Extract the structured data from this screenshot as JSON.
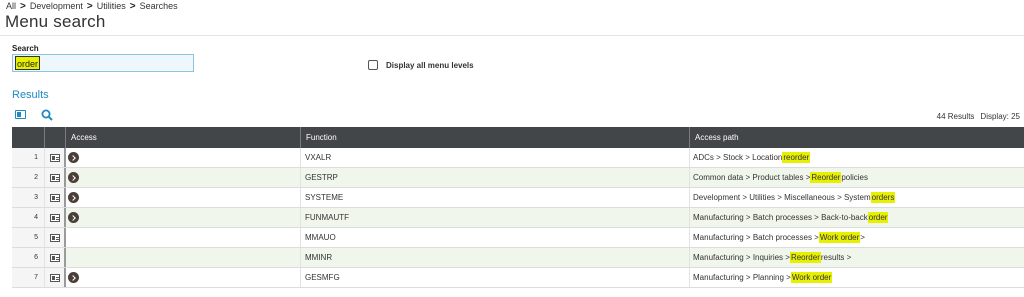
{
  "breadcrumb": {
    "items": [
      "All",
      "Development",
      "Utilities",
      "Searches"
    ],
    "separator": ">"
  },
  "page_title": "Menu search",
  "search": {
    "label": "Search",
    "value": "order"
  },
  "display_all_levels": {
    "label": "Display all menu levels",
    "checked": false
  },
  "results": {
    "title": "Results",
    "count_text": "44 Results",
    "display_text": "Display: 25",
    "columns": {
      "access": "Access",
      "function": "Function",
      "access_path": "Access path"
    },
    "rows": [
      {
        "num": "1",
        "has_access": true,
        "function": "VXALR",
        "path_pre": "ADCs > Stock > Location ",
        "path_hl": "reorder",
        "path_post": ""
      },
      {
        "num": "2",
        "has_access": true,
        "function": "GESTRP",
        "path_pre": "Common data > Product tables > ",
        "path_hl": "Reorder",
        "path_post": " policies"
      },
      {
        "num": "3",
        "has_access": true,
        "function": "SYSTEME",
        "path_pre": "Development > Utilities > Miscellaneous > System ",
        "path_hl": "orders",
        "path_post": ""
      },
      {
        "num": "4",
        "has_access": true,
        "function": "FUNMAUTF",
        "path_pre": "Manufacturing > Batch processes > Back-to-back ",
        "path_hl": "order",
        "path_post": ""
      },
      {
        "num": "5",
        "has_access": false,
        "function": "MMAUO",
        "path_pre": "Manufacturing > Batch processes > ",
        "path_hl": "Work order",
        "path_post": " >"
      },
      {
        "num": "6",
        "has_access": false,
        "function": "MMINR",
        "path_pre": "Manufacturing > Inquiries > ",
        "path_hl": "Reorder",
        "path_post": " results >"
      },
      {
        "num": "7",
        "has_access": true,
        "function": "GESMFG",
        "path_pre": "Manufacturing > Planning > ",
        "path_hl": "Work order",
        "path_post": ""
      }
    ]
  },
  "icons": {
    "toolbar_view": "grid-view-icon",
    "toolbar_search": "search-icon",
    "row_view": "row-detail-icon",
    "row_access": "chevron-right-circle-icon"
  },
  "colors": {
    "accent": "#1f8ac0",
    "highlight": "#e6f000",
    "header_bg": "#434649",
    "access_button": "#4a3f38"
  }
}
